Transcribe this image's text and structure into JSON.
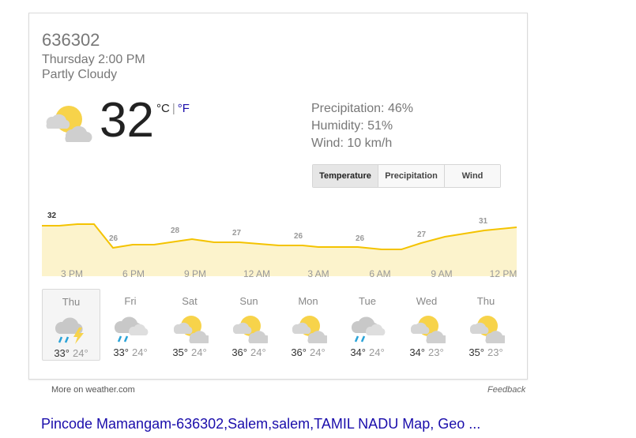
{
  "weather": {
    "location": "636302",
    "datetime": "Thursday 2:00 PM",
    "condition": "Partly Cloudy",
    "current_icon": "partly-cloudy-icon",
    "temperature": "32",
    "unit_c": "°C",
    "unit_sep": "|",
    "unit_f": "°F",
    "precipitation": "Precipitation: 46%",
    "humidity": "Humidity: 51%",
    "wind": "Wind: 10 km/h",
    "tabs": [
      "Temperature",
      "Precipitation",
      "Wind"
    ],
    "active_tab": "Temperature",
    "hours": [
      "3 PM",
      "6 PM",
      "9 PM",
      "12 AM",
      "3 AM",
      "6 AM",
      "9 AM",
      "12 PM"
    ],
    "temp_labels": [
      "32",
      "26",
      "28",
      "27",
      "26",
      "26",
      "27",
      "31"
    ],
    "days": [
      {
        "name": "Thu",
        "hi": "33°",
        "lo": "24°",
        "icon": "thunderstorm-icon"
      },
      {
        "name": "Fri",
        "hi": "33°",
        "lo": "24°",
        "icon": "rain-icon"
      },
      {
        "name": "Sat",
        "hi": "35°",
        "lo": "24°",
        "icon": "partly-cloudy-icon"
      },
      {
        "name": "Sun",
        "hi": "36°",
        "lo": "24°",
        "icon": "partly-cloudy-icon"
      },
      {
        "name": "Mon",
        "hi": "36°",
        "lo": "24°",
        "icon": "partly-cloudy-icon"
      },
      {
        "name": "Tue",
        "hi": "34°",
        "lo": "24°",
        "icon": "rain-icon"
      },
      {
        "name": "Wed",
        "hi": "34°",
        "lo": "23°",
        "icon": "partly-cloudy-icon"
      },
      {
        "name": "Thu",
        "hi": "35°",
        "lo": "23°",
        "icon": "partly-cloudy-icon"
      }
    ],
    "colors": {
      "line": "#f4c300",
      "fill": "#fcf3cc",
      "sun": "#f7d34a",
      "cloud": "#d5d5d5",
      "rain": "#29a3d8",
      "link": "#1a0dab"
    }
  },
  "footer": {
    "source": "More on weather.com",
    "feedback": "Feedback"
  },
  "result": {
    "title": "Pincode Mamangam-636302,Salem,salem,TAMIL NADU Map, Geo ..."
  }
}
